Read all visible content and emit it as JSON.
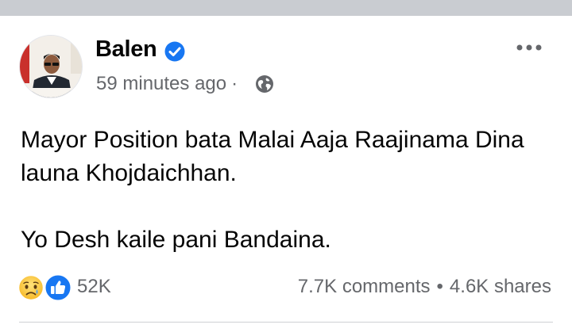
{
  "post": {
    "author": "Balen",
    "timestamp": "59 minutes ago",
    "meta_separator": "·",
    "audience_icon": "globe-icon",
    "verified_icon": "verified-badge-icon",
    "text_line_1": "Mayor Position bata Malai Aaja Raajinama Dina launa Khojdaichhan.",
    "text_line_2": "Yo Desh kaile pani Bandaina."
  },
  "reactions": {
    "types": [
      "sad",
      "like"
    ],
    "count": "52K"
  },
  "stats": {
    "comments": "7.7K comments",
    "separator": "•",
    "shares": "4.6K shares"
  },
  "colors": {
    "verified": "#1877f2",
    "secondary_text": "#65676b",
    "top_band": "#c9ccd1"
  }
}
